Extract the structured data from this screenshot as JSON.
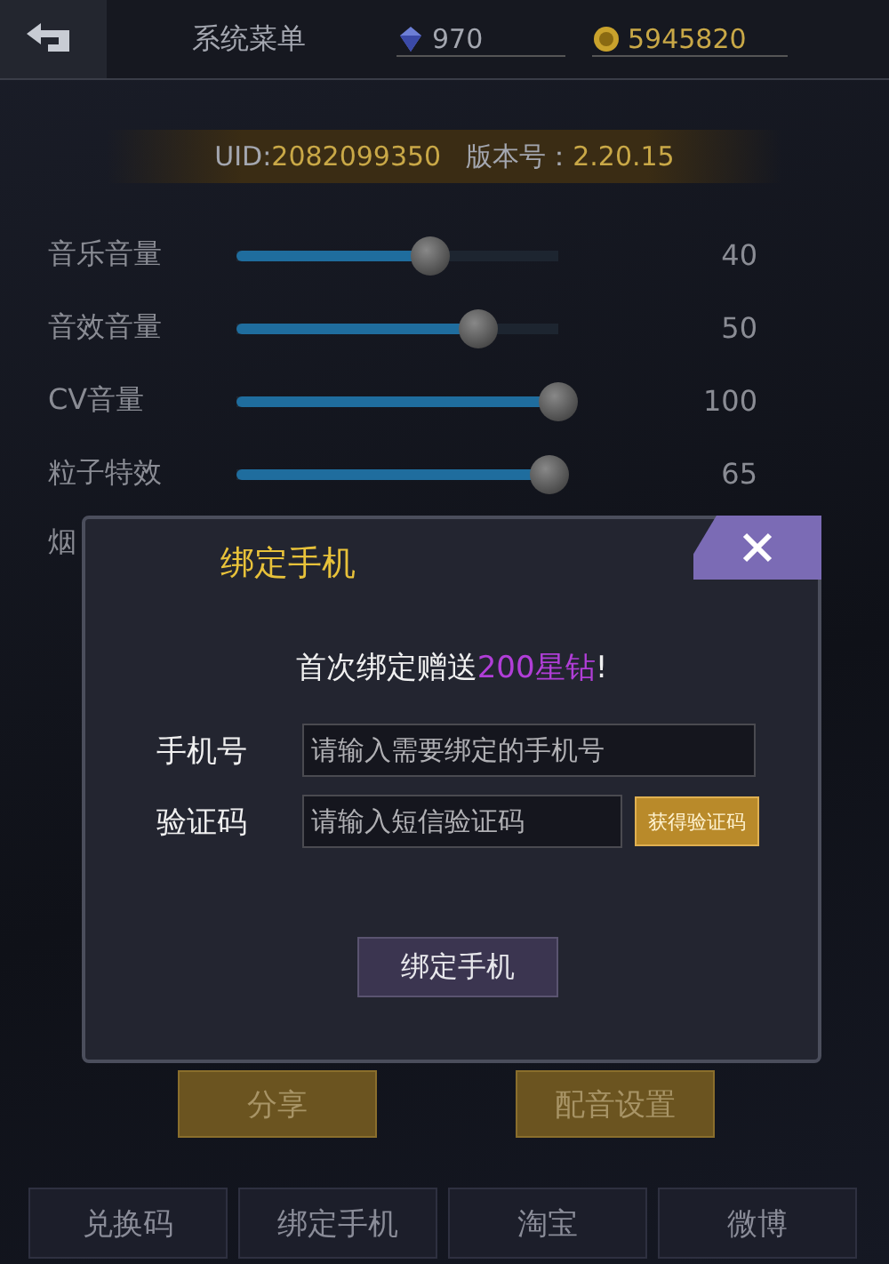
{
  "header": {
    "title": "系统菜单",
    "diamonds": "970",
    "coins": "5945820"
  },
  "info": {
    "uid_label": "UID:",
    "uid": "2082099350",
    "version_label": "版本号：",
    "version": "2.20.15"
  },
  "sliders": [
    {
      "label": "音乐音量",
      "level": 0.6,
      "reading": "40"
    },
    {
      "label": "音效音量",
      "level": 0.75,
      "reading": "50"
    },
    {
      "label": "CV音量",
      "level": 1.0,
      "reading": "100"
    },
    {
      "label": "粒子特效",
      "level": 0.97,
      "reading": "65"
    }
  ],
  "covered_rows": [
    "烟"
  ],
  "actions": [
    "分享",
    "配音设置"
  ],
  "bottom_tabs": [
    "兑换码",
    "绑定手机",
    "淘宝",
    "微博"
  ],
  "dialog": {
    "title": "绑定手机",
    "message_prefix": "首次绑定赠送",
    "message_highlight": "200星钻",
    "message_suffix": "!",
    "fields": [
      {
        "kind": "input",
        "label": "手机号",
        "placeholder": "请输入需要绑定的手机号"
      },
      {
        "kind": "code",
        "label": "验证码",
        "placeholder": "请输入短信验证码",
        "button": "获得验证码"
      }
    ],
    "submit": "绑定手机"
  }
}
